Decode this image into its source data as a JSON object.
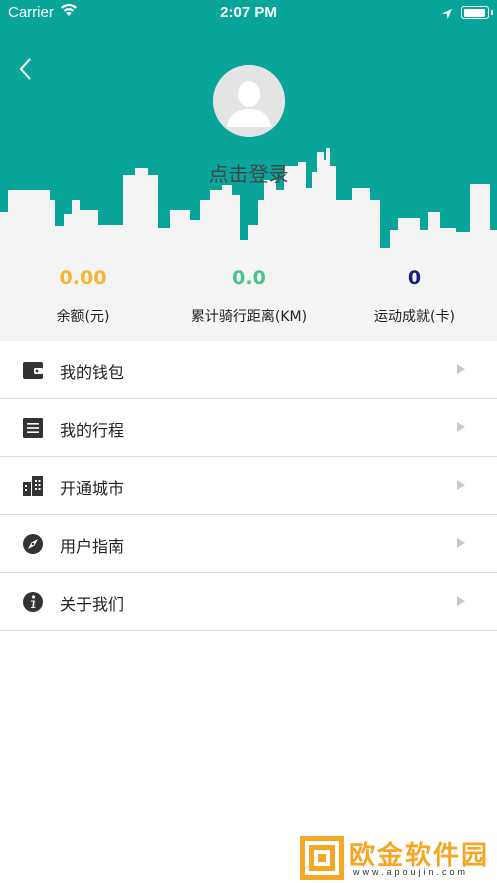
{
  "status_bar": {
    "carrier": "Carrier",
    "time": "2:07 PM",
    "icons": [
      "wifi-icon",
      "location-arrow-icon",
      "battery-icon"
    ]
  },
  "header": {
    "background_color": "#0aa59a",
    "back_icon": "chevron-left-icon",
    "avatar_icon": "default-avatar",
    "login_text": "点击登录"
  },
  "stats": [
    {
      "value": "0.00",
      "label": "余额(元)",
      "color": "#f5b731"
    },
    {
      "value": "0.0",
      "label": "累计骑行距离(KM)",
      "color": "#47c28f"
    },
    {
      "value": "0",
      "label": "运动成就(卡)",
      "color": "#1a1f7a"
    }
  ],
  "menu": [
    {
      "label": "我的钱包",
      "icon": "wallet-icon"
    },
    {
      "label": "我的行程",
      "icon": "list-icon"
    },
    {
      "label": "开通城市",
      "icon": "buildings-icon"
    },
    {
      "label": "用户指南",
      "icon": "compass-icon"
    },
    {
      "label": "关于我们",
      "icon": "info-icon"
    }
  ],
  "watermark": {
    "title": "欧金软件园",
    "url": "www.apoujin.com",
    "color": "#f5a623"
  }
}
